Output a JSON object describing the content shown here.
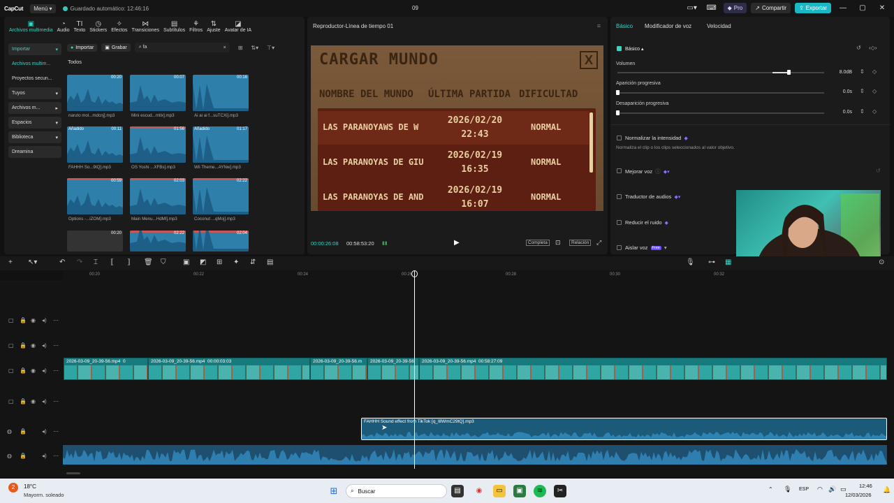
{
  "titlebar": {
    "brand": "CapCut",
    "menu": "Menú",
    "autosave": "Guardado automático: 12:46:16",
    "project": "09",
    "pro": "Pro",
    "share": "Compartir",
    "export": "Exportar"
  },
  "toolbar": {
    "items": [
      {
        "label": "Archivos multimedia",
        "icon": "▣"
      },
      {
        "label": "Audio",
        "icon": "◔"
      },
      {
        "label": "Texto",
        "icon": "TI"
      },
      {
        "label": "Stickers",
        "icon": "◷"
      },
      {
        "label": "Efectos",
        "icon": "✧"
      },
      {
        "label": "Transiciones",
        "icon": "⋈"
      },
      {
        "label": "Subtítulos",
        "icon": "▤"
      },
      {
        "label": "Filtros",
        "icon": "⚘"
      },
      {
        "label": "Ajuste",
        "icon": "⇅"
      },
      {
        "label": "Avatar de IA",
        "icon": "◪"
      }
    ]
  },
  "sidenav": [
    {
      "label": "Importar",
      "style": "box accent",
      "caret": "▾"
    },
    {
      "label": "Archivos multim...",
      "style": "accent",
      "caret": ""
    },
    {
      "label": "Proyectos secun...",
      "style": "",
      "caret": ""
    },
    {
      "label": "Tuyos",
      "style": "box",
      "caret": "▾"
    },
    {
      "label": "Archivos m...",
      "style": "box",
      "caret": "▸"
    },
    {
      "label": "Espacios",
      "style": "box",
      "caret": "▾"
    },
    {
      "label": "Biblioteca",
      "style": "box",
      "caret": "▾"
    },
    {
      "label": "Dreamina",
      "style": "box",
      "caret": ""
    }
  ],
  "media": {
    "import": "Importar",
    "record": "Grabar",
    "search_value": "fa",
    "filter_all": "Todos",
    "items": [
      {
        "label": "naruto mol...mdcnj].mp3",
        "duration": "00:20",
        "added": ""
      },
      {
        "label": "Mini escud...mtlx].mp3",
        "duration": "00:07",
        "added": ""
      },
      {
        "label": "Ai ai ai f...suTCXi].mp3",
        "duration": "00:16",
        "added": ""
      },
      {
        "label": "FAHHH So...9tQ].mp3",
        "duration": "00:11",
        "added": "Añadido"
      },
      {
        "label": "OS Yoshi ...XFBs].mp3",
        "duration": "01:56",
        "added": ""
      },
      {
        "label": "Wii Theme...AYNw].mp3",
        "duration": "01:17",
        "added": "Añadido"
      },
      {
        "label": "Options -...iZOM].mp3",
        "duration": "00:59",
        "added": ""
      },
      {
        "label": "Main Menu...HdMl].mp3",
        "duration": "02:03",
        "added": ""
      },
      {
        "label": "Coconut ...qMoj].mp3",
        "duration": "02:22",
        "added": ""
      },
      {
        "label": "",
        "duration": "00:20",
        "added": ""
      },
      {
        "label": "",
        "duration": "02:22",
        "added": ""
      },
      {
        "label": "",
        "duration": "02:04",
        "added": ""
      }
    ]
  },
  "player": {
    "title": "Reproductor-Línea de tiempo 01",
    "current": "00:00:26:08",
    "total": "00:58:53:20",
    "full": "Completa",
    "ratio": "Relación",
    "game": {
      "title": "CARGAR MUNDO",
      "close": "X",
      "col_name": "NOMBRE DEL MUNDO",
      "col_last": "ÚLTIMA PARTIDA",
      "col_diff": "DIFICULTAD",
      "rows": [
        {
          "name": "LAS PARANOYAWS DE W",
          "date": "2026/02/20",
          "time": "22:43",
          "diff": "NORMAL"
        },
        {
          "name": "LAS PARANOYAS DE GIU",
          "date": "2026/02/19",
          "time": "16:35",
          "diff": "NORMAL"
        },
        {
          "name": "LAS PARANOYAS DE AND",
          "date": "2026/02/19",
          "time": "16:07",
          "diff": "NORMAL"
        }
      ]
    }
  },
  "props": {
    "tabs": [
      "Básico",
      "Modificador de voz",
      "Velocidad"
    ],
    "section": "Básico",
    "volume_label": "Volumen",
    "volume_value": "8.0dB",
    "volume_fraction": 0.82,
    "fadein_label": "Aparición progresiva",
    "fadein_value": "0.0s",
    "fadeout_label": "Desaparición progresiva",
    "fadeout_value": "0.0s",
    "normalize": "Normalizar la intensidad",
    "normalize_desc": "Normaliza el clip o los clips seleccionados al valor objetivo.",
    "enhance": "Mejorar voz",
    "translate": "Traductor de audios",
    "reduce": "Reducir el ruido",
    "isolate": "Aislar voz",
    "free_badge": "Free"
  },
  "timeline": {
    "ticks": [
      "00:20",
      "00:22",
      "00:24",
      "00:26",
      "00:28",
      "00:30",
      "00:32"
    ],
    "video_clips": [
      {
        "name": "2026-03-09_20-39-56.mp4",
        "extra": "0"
      },
      {
        "name": "2026-03-09_20-39-56.mp4",
        "extra": "00:00:03:03"
      },
      {
        "name": "2026-03-09_20-39-56.m",
        "extra": ""
      },
      {
        "name": "2026-03-09_20-39-56",
        "extra": ""
      },
      {
        "name": "2026-03-09_20-39-56.mp4",
        "extra": "00:58:27:09"
      }
    ],
    "audio_clip": "FAHHH Sound effect from TikTok [q_l8WmC29tQ].mp3"
  },
  "taskbar": {
    "temp": "18°C",
    "weather": "Mayorm. soleado",
    "search": "Buscar",
    "lang": "ESP",
    "time": "12:46",
    "date": "12/03/2026",
    "badge": "2"
  }
}
